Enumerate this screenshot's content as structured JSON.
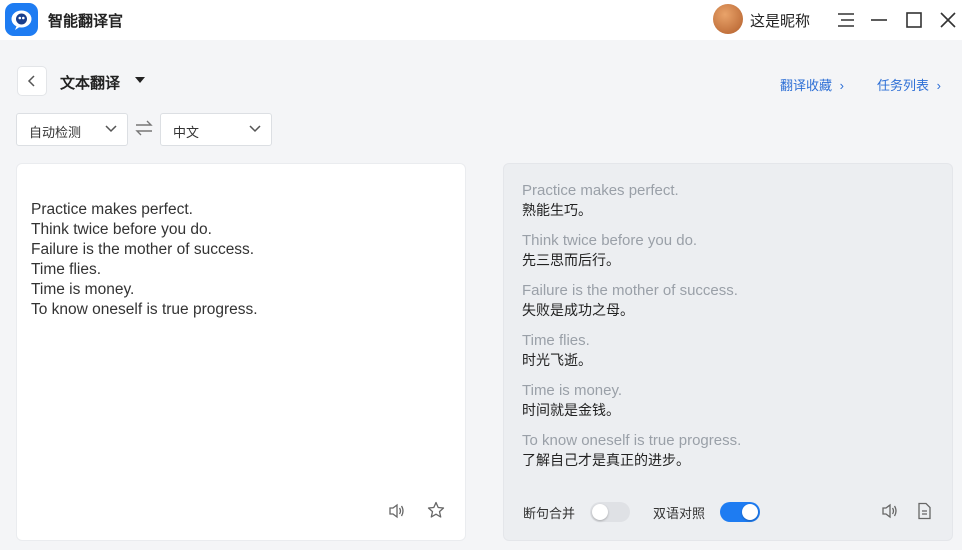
{
  "app": {
    "title": "智能翻译官"
  },
  "user": {
    "name": "这是昵称"
  },
  "header": {
    "mode": "文本翻译",
    "links": {
      "favorites": "翻译收藏",
      "tasks": "任务列表"
    }
  },
  "languages": {
    "source": "自动检测",
    "target": "中文"
  },
  "source": {
    "lines": [
      "Practice makes perfect.",
      "Think twice before you do.",
      "Failure is the mother of success.",
      "Time flies.",
      "Time is money.",
      "To know oneself is true progress."
    ]
  },
  "result": {
    "pairs": [
      {
        "en": "Practice makes perfect.",
        "zh": "熟能生巧。"
      },
      {
        "en": "Think twice before you do.",
        "zh": "先三思而后行。"
      },
      {
        "en": "Failure is the mother of success.",
        "zh": "失败是成功之母。"
      },
      {
        "en": "Time flies.",
        "zh": "时光飞逝。"
      },
      {
        "en": "Time is money.",
        "zh": "时间就是金钱。"
      },
      {
        "en": "To know oneself is true progress.",
        "zh": "了解自己才是真正的进步。"
      }
    ],
    "merge_sentences": {
      "label": "断句合并",
      "on": false
    },
    "bilingual": {
      "label": "双语对照",
      "on": true
    }
  },
  "colors": {
    "accent": "#1e7cf2",
    "link": "#2d6fd6"
  }
}
